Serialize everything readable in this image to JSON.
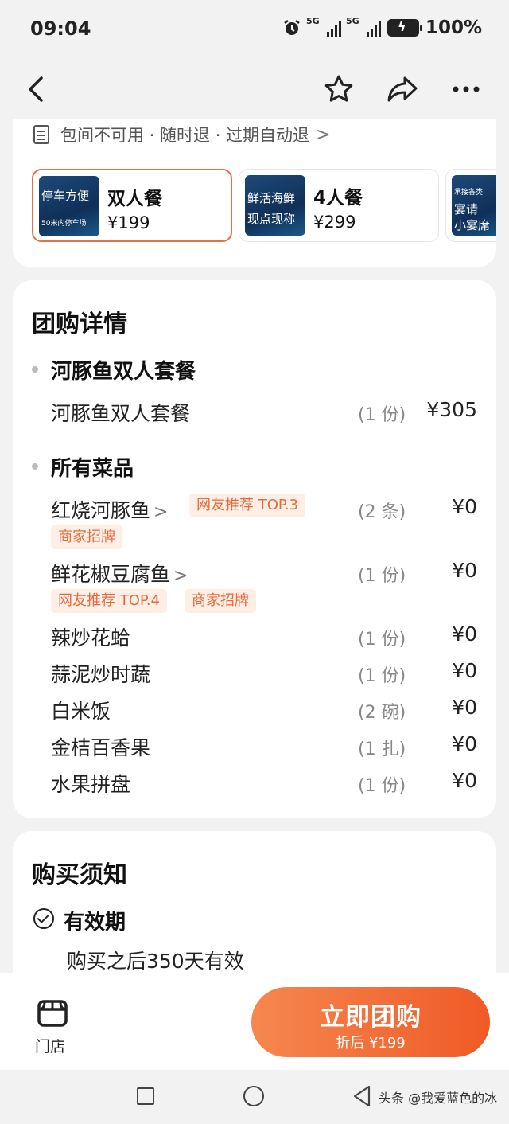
{
  "status_bar": {
    "time": "09:04",
    "net1": "5G",
    "net2": "5G",
    "battery": "100%"
  },
  "nav": {
    "icons": [
      "back-arrow-icon",
      "star-icon",
      "share-icon",
      "more-icon"
    ]
  },
  "policy": {
    "text": "包间不可用 · 随时退 · 过期自动退",
    "chevron": ">"
  },
  "packages": [
    {
      "name": "双人餐",
      "price": "¥199",
      "thumb_line1": "停车方便",
      "thumb_line2": "50米内停车场",
      "selected": true
    },
    {
      "name": "4人餐",
      "price": "¥299",
      "thumb_line1": "鲜活海鲜",
      "thumb_line2": "现点现称",
      "selected": false
    },
    {
      "name": "",
      "price": "",
      "thumb_line1": "承接各类",
      "thumb_line2": "宴请",
      "thumb_line3": "小宴席",
      "selected": false
    }
  ],
  "details": {
    "title": "团购详情",
    "set_group": {
      "title": "河豚鱼双人套餐",
      "items": [
        {
          "name": "河豚鱼双人套餐",
          "qty": "(1 份)",
          "price": "¥305"
        }
      ]
    },
    "dishes_group": {
      "title": "所有菜品",
      "items": [
        {
          "name": "红烧河豚鱼",
          "arrow": ">",
          "qty": "(2 条)",
          "price": "¥0",
          "tags": [
            "网友推荐 TOP.3",
            "商家招牌"
          ]
        },
        {
          "name": "鲜花椒豆腐鱼",
          "arrow": ">",
          "qty": "(1 份)",
          "price": "¥0",
          "tags": [
            "网友推荐 TOP.4",
            "商家招牌"
          ]
        },
        {
          "name": "辣炒花蛤",
          "qty": "(1 份)",
          "price": "¥0"
        },
        {
          "name": "蒜泥炒时蔬",
          "qty": "(1 份)",
          "price": "¥0"
        },
        {
          "name": "白米饭",
          "qty": "(2 碗)",
          "price": "¥0"
        },
        {
          "name": "金桔百香果",
          "qty": "(1 扎)",
          "price": "¥0"
        },
        {
          "name": "水果拼盘",
          "qty": "(1 份)",
          "price": "¥0"
        }
      ]
    }
  },
  "notice": {
    "title": "购买须知",
    "validity_title": "有效期",
    "validity_text": "购买之后350天有效"
  },
  "bottom_bar": {
    "store_label": "门店",
    "buy_label": "立即团购",
    "buy_sub": "折后 ¥199"
  },
  "system_nav": {
    "watermark": "头条 @我爱蓝色的冰"
  },
  "colors": {
    "accent": "#ef5a26",
    "tag_bg": "#fdeee6",
    "tag_text": "#e86a3a"
  }
}
